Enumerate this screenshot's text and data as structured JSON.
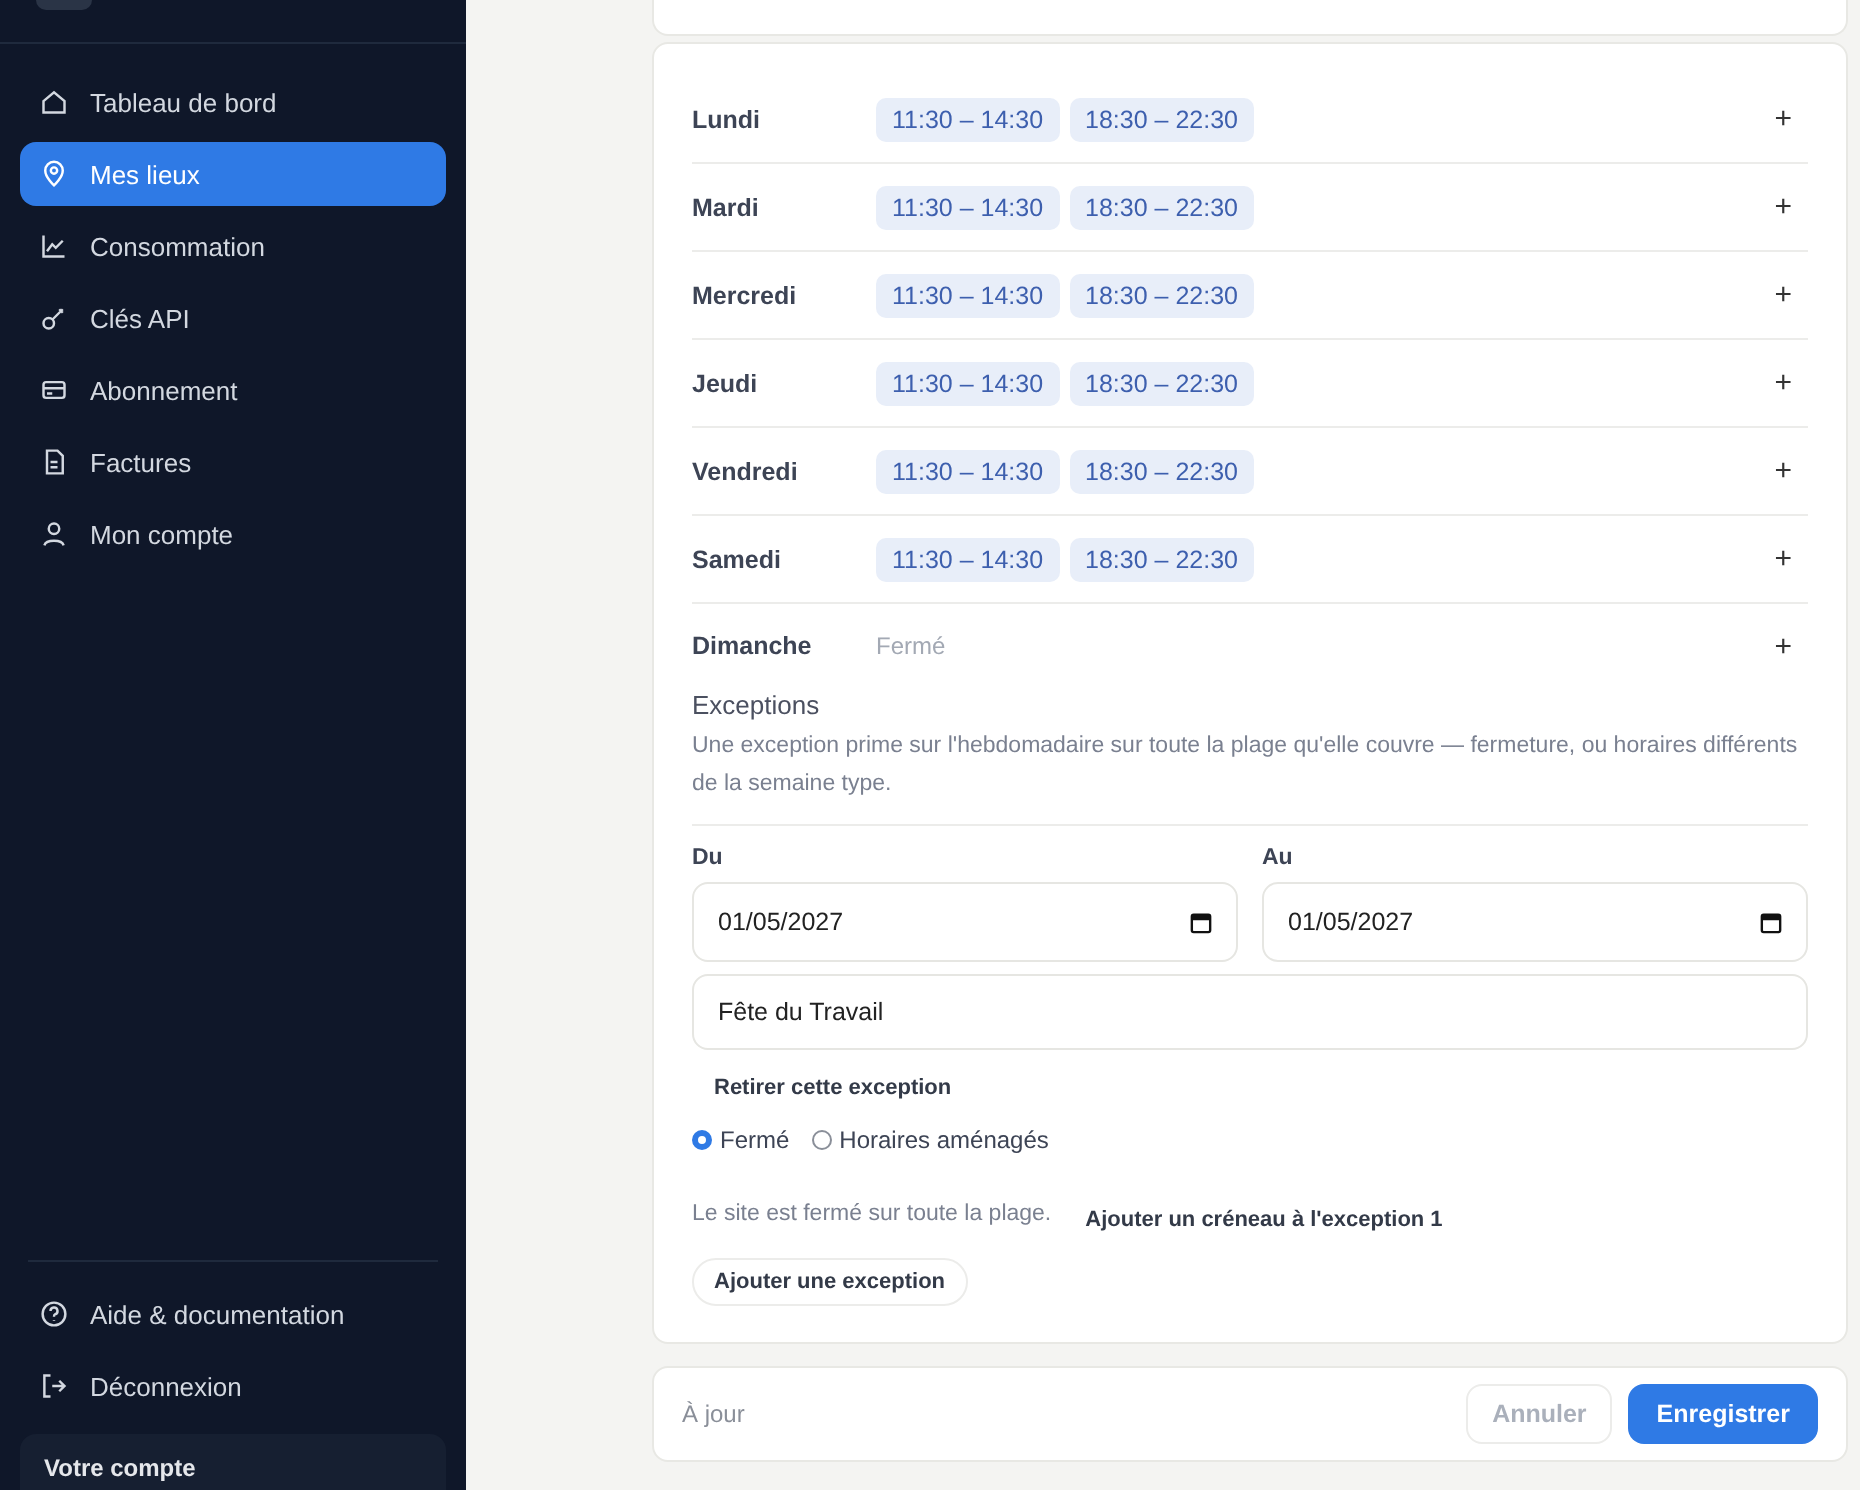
{
  "sidebar": {
    "nav": [
      {
        "label": "Tableau de bord",
        "selected": false
      },
      {
        "label": "Mes lieux",
        "selected": true
      },
      {
        "label": "Consommation",
        "selected": false
      },
      {
        "label": "Clés API",
        "selected": false
      },
      {
        "label": "Abonnement",
        "selected": false
      },
      {
        "label": "Factures",
        "selected": false
      },
      {
        "label": "Mon compte",
        "selected": false
      }
    ],
    "footer_links": [
      {
        "label": "Aide & documentation"
      },
      {
        "label": "Déconnexion"
      }
    ],
    "account_card": {
      "title": "Votre compte"
    }
  },
  "schedule": {
    "days": [
      {
        "name": "Lundi",
        "slots": [
          "11:30 – 14:30",
          "18:30 – 22:30"
        ]
      },
      {
        "name": "Mardi",
        "slots": [
          "11:30 – 14:30",
          "18:30 – 22:30"
        ]
      },
      {
        "name": "Mercredi",
        "slots": [
          "11:30 – 14:30",
          "18:30 – 22:30"
        ]
      },
      {
        "name": "Jeudi",
        "slots": [
          "11:30 – 14:30",
          "18:30 – 22:30"
        ]
      },
      {
        "name": "Vendredi",
        "slots": [
          "11:30 – 14:30",
          "18:30 – 22:30"
        ]
      },
      {
        "name": "Samedi",
        "slots": [
          "11:30 – 14:30",
          "18:30 – 22:30"
        ]
      },
      {
        "name": "Dimanche",
        "closed_label": "Fermé"
      }
    ],
    "add_symbol": "+"
  },
  "exceptions": {
    "title": "Exceptions",
    "description": "Une exception prime sur l'hebdomadaire sur toute la plage qu'elle couvre — fermeture, ou horaires différents de la semaine type.",
    "items": [
      {
        "from_label": "Du",
        "from_value": "01/05/2027",
        "to_label": "Au",
        "to_value": "01/05/2027",
        "name_value": "Fête du Travail",
        "remove_label": "Retirer cette exception",
        "modes": [
          {
            "label": "Fermé",
            "selected": true
          },
          {
            "label": "Horaires aménagés",
            "selected": false
          }
        ],
        "closed_note": "Le site est fermé sur toute la plage.",
        "add_slot_label": "Ajouter un créneau à l'exception 1"
      }
    ],
    "add_label": "Ajouter une exception"
  },
  "footer": {
    "status": "À jour",
    "cancel": "Annuler",
    "save": "Enregistrer"
  }
}
